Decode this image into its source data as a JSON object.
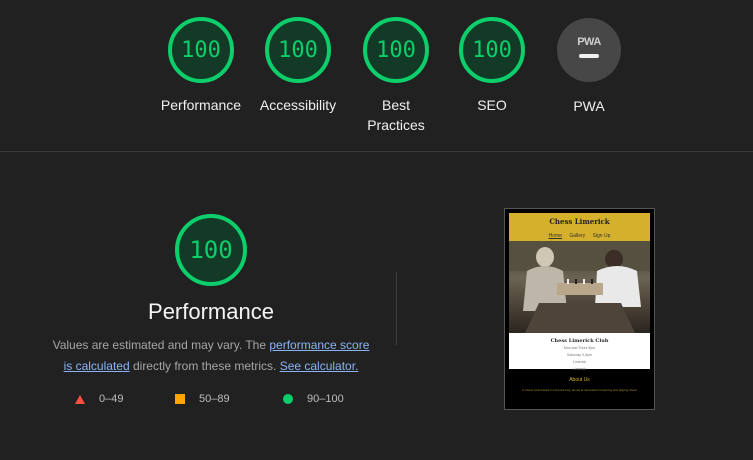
{
  "gauges": [
    {
      "score": "100",
      "label": "Performance"
    },
    {
      "score": "100",
      "label": "Accessibility"
    },
    {
      "score": "100",
      "label": "Best Practices"
    },
    {
      "score": "100",
      "label": "SEO"
    },
    {
      "badge": "PWA",
      "label": "PWA"
    }
  ],
  "performance": {
    "score": "100",
    "title": "Performance",
    "desc_prefix": "Values are estimated and may vary. The ",
    "link_score": "performance score is calculated",
    "desc_middle": " directly from these metrics. ",
    "link_calc": "See calculator."
  },
  "legend": [
    {
      "range": "0–49",
      "color": "#ff4e42"
    },
    {
      "range": "50–89",
      "color": "#ffa400"
    },
    {
      "range": "90–100",
      "color": "#0cce6b"
    }
  ],
  "thumbnail": {
    "site_title": "Chess Limerick",
    "nav": [
      "Home",
      "Gallery",
      "Sign Up"
    ],
    "card_title": "Chess Limerick Club",
    "card_lines": [
      "Mon and Thurs 9pm",
      "Saturday 9-5pm",
      "Limerick",
      "Limerick"
    ],
    "about_title": "About Us",
    "about_text": "A Chess Club based in Limerick City, aimed at interested in learning and playing chess"
  },
  "colors": {
    "pass": "#0cce6b",
    "average": "#ffa400",
    "fail": "#ff4e42",
    "background": "#212121"
  }
}
